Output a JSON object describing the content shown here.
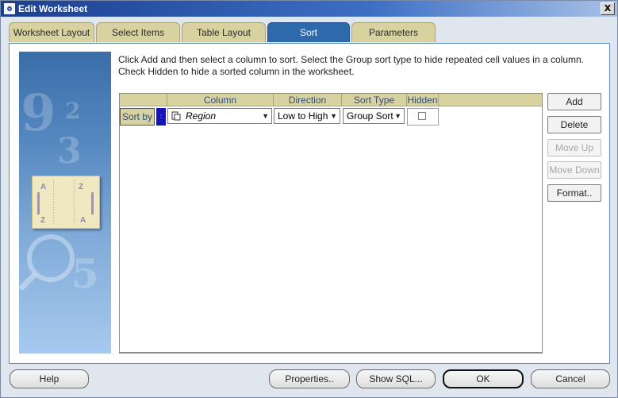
{
  "window": {
    "title": "Edit Worksheet",
    "close_label": "X"
  },
  "tabs": [
    {
      "label": "Worksheet Layout"
    },
    {
      "label": "Select Items"
    },
    {
      "label": "Table Layout"
    },
    {
      "label": "Sort"
    },
    {
      "label": "Parameters"
    }
  ],
  "active_tab": "Sort",
  "instructions": "Click Add and then select a column to sort. Select the Group sort type to hide repeated cell values in a column. Check Hidden to hide a sorted column in the worksheet.",
  "grid": {
    "columns": [
      "Column",
      "Direction",
      "Sort Type",
      "Hidden"
    ],
    "row_header_label": "Sort by",
    "row_selector": ":",
    "rows": [
      {
        "column": "Region",
        "direction": "Low to High",
        "sort_type": "Group Sort",
        "hidden": false
      }
    ]
  },
  "sort_icon": {
    "left_top": "A",
    "left_bottom": "Z",
    "right_top": "Z",
    "right_bottom": "A"
  },
  "side_buttons": {
    "add": "Add",
    "delete": "Delete",
    "move_up": "Move Up",
    "move_down": "Move Down",
    "format": "Format.."
  },
  "footer_buttons": {
    "help": "Help",
    "properties": "Properties..",
    "show_sql": "Show SQL...",
    "ok": "OK",
    "cancel": "Cancel"
  },
  "colors": {
    "accent": "#2d69ab",
    "tab_bg": "#d7d2a0",
    "dialog_bg": "#dfe6ee"
  }
}
